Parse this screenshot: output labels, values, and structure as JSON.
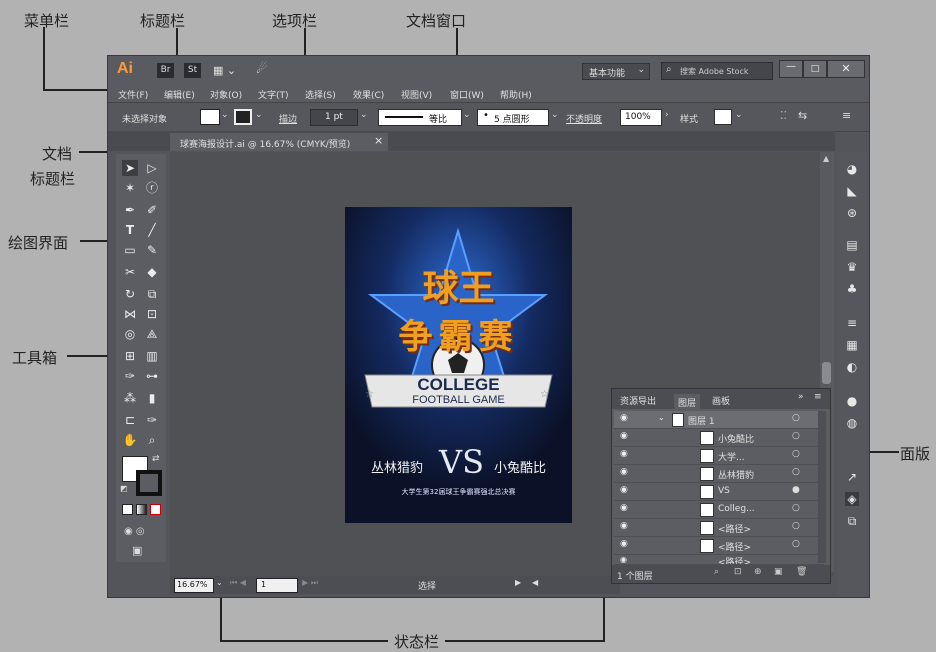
{
  "annotations": {
    "menubar": "菜单栏",
    "titlebar": "标题栏",
    "optionsbar": "选项栏",
    "docwindow": "文档窗口",
    "doctitle_1": "文档",
    "doctitle_2": "标题栏",
    "drawing": "绘图界面",
    "toolbox": "工具箱",
    "panel": "面版",
    "statusbar": "状态栏"
  },
  "app": {
    "logo": "Ai",
    "br": "Br",
    "st": "St",
    "workspace": "基本功能",
    "search_placeholder": "搜索 Adobe Stock"
  },
  "menu": [
    "文件(F)",
    "编辑(E)",
    "对象(O)",
    "文字(T)",
    "选择(S)",
    "效果(C)",
    "视图(V)",
    "窗口(W)",
    "帮助(H)"
  ],
  "options": {
    "selection": "未选择对象",
    "stroke_label": "描边",
    "stroke_value": "1 pt",
    "uniform": "等比",
    "brush": "5 点圆形",
    "opacity_label": "不透明度",
    "opacity_value": "100%",
    "style_label": "样式"
  },
  "document": {
    "tab_title": "球赛海报设计.ai @ 16.67% (CMYK/预览)",
    "close": "×"
  },
  "poster": {
    "title_line1": "球王",
    "title_line2": "争霸赛",
    "banner_line1": "COLLEGE",
    "banner_line2": "FOOTBALL GAME",
    "team_left": "丛林猎豹",
    "vs": "VS",
    "team_right": "小兔酷比",
    "subtitle": "大学生第32届球王争霸赛强北总决赛"
  },
  "status": {
    "zoom": "16.67%",
    "page": "1",
    "mode": "选择"
  },
  "layers_panel": {
    "tabs": [
      "资源导出",
      "图层",
      "画板"
    ],
    "rows": [
      {
        "name": "图层 1"
      },
      {
        "name": "小兔酷比"
      },
      {
        "name": "大学..."
      },
      {
        "name": "丛林猎豹"
      },
      {
        "name": "VS"
      },
      {
        "name": "Colleg..."
      },
      {
        "name": "<路径>"
      },
      {
        "name": "<路径>"
      },
      {
        "name": "<路径>"
      }
    ],
    "footer": "1 个图层"
  },
  "colors": {
    "accent_panel": "#6c6d73",
    "poster_bg": "#101a34",
    "gold": "#e8a020"
  }
}
